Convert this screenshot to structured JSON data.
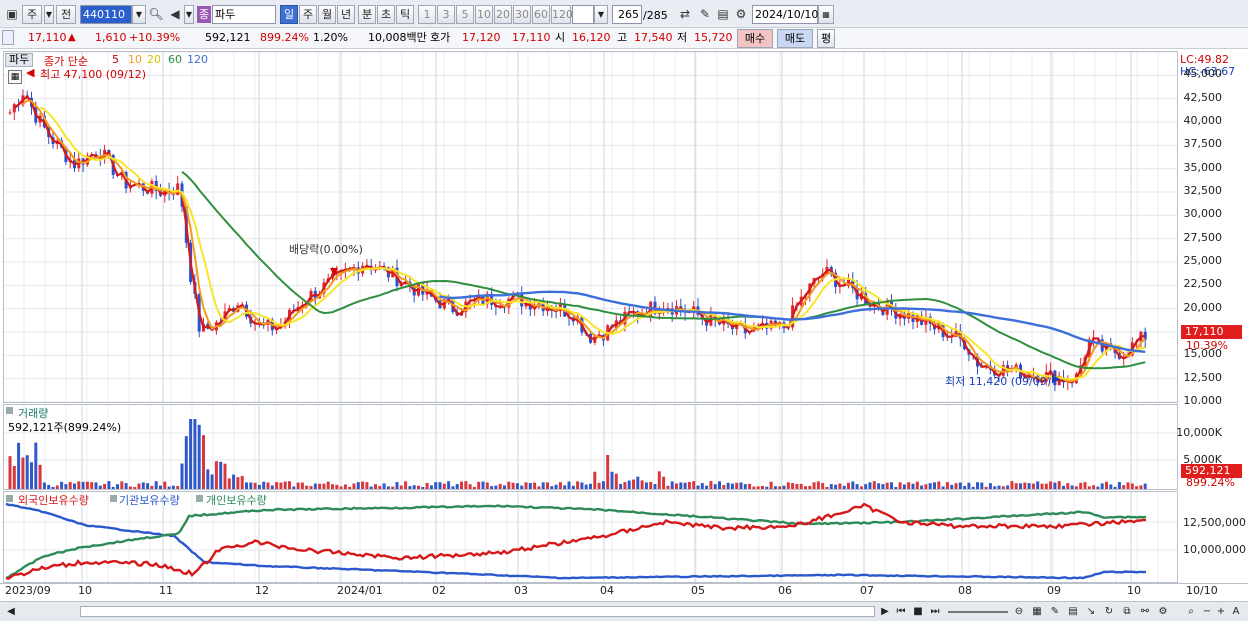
{
  "toolbar": {
    "market_label": "주",
    "prev_label": "전",
    "code": "440110",
    "name_badge": "종",
    "name": "파두",
    "periods": [
      "일",
      "주",
      "월",
      "년",
      "분",
      "초",
      "틱"
    ],
    "intervals": [
      "1",
      "3",
      "5",
      "10",
      "20",
      "30",
      "60",
      "120"
    ],
    "count": "265",
    "count_total": "/285",
    "date": "2024/10/10"
  },
  "quote": {
    "price": "17,110",
    "change": "1,610",
    "change_pct": "+10.39%",
    "volume": "592,121",
    "volume_pct": "899.24%",
    "turnover_pct": "1.20%",
    "amount": "10,008백만",
    "ask_label": "호가",
    "ask": "17,120",
    "bid": "17,110",
    "open_label": "시",
    "open": "16,120",
    "high_label": "고",
    "high": "17,540",
    "low_label": "저",
    "low": "15,720",
    "buy_button": "매수",
    "sell_button": "매도",
    "eval_button": "평"
  },
  "price_panel": {
    "stock_tag": "파두",
    "legend_title": "종가 단순",
    "ma_periods": [
      "5",
      "10",
      "20",
      "60",
      "120"
    ],
    "ma_colors": [
      "#cc0000",
      "#f39b1f",
      "#f7e52a",
      "#2f8f3e",
      "#3c6fd9"
    ],
    "high_note": "최고 47,100 (09/12)",
    "low_note": "최저 11,420 (09/09)",
    "dividend_note": "배당락(0.00%)",
    "lc": "LC:49.82",
    "hc": "HC:-63.67",
    "current_price": "17,110",
    "current_pct": "10.39%",
    "y_ticks": [
      "45,000",
      "42,500",
      "40,000",
      "37,500",
      "35,000",
      "32,500",
      "30,000",
      "27,500",
      "25,000",
      "22,500",
      "20,000",
      "15,000",
      "12,500",
      "10,000"
    ]
  },
  "volume_panel": {
    "title": "거래량",
    "value_note": "592,121주(899.24%)",
    "y_ticks": [
      "10,000K",
      "5,000K"
    ],
    "current_value": "592,121",
    "current_pct": "899.24%"
  },
  "holding_panel": {
    "legend": [
      "외국인보유수량",
      "기관보유수량",
      "개인보유수량"
    ],
    "colors": [
      "#d51818",
      "#2a58cc",
      "#2e8b57"
    ],
    "y_ticks": [
      "12,500,000",
      "10,000,000"
    ]
  },
  "x_axis": {
    "labels": [
      "2023/09",
      "10",
      "11",
      "12",
      "2024/01",
      "02",
      "03",
      "04",
      "05",
      "06",
      "07",
      "08",
      "09",
      "10"
    ],
    "end_label": "10/10"
  },
  "chart_data": {
    "type": "candlestick",
    "dates_range": [
      "2023/09",
      "2024/10/10"
    ],
    "close_series": [
      {
        "date": "2023/09",
        "close": 40000
      },
      {
        "date": "2023/10",
        "close": 35500
      },
      {
        "date": "2023/11",
        "close": 32000
      },
      {
        "date": "2023/11 late",
        "close": 18000
      },
      {
        "date": "2023/12",
        "close": 18500
      },
      {
        "date": "2024/01",
        "close": 24000
      },
      {
        "date": "2024/02",
        "close": 21000
      },
      {
        "date": "2024/03",
        "close": 19000
      },
      {
        "date": "2024/04",
        "close": 20500
      },
      {
        "date": "2024/05",
        "close": 18000
      },
      {
        "date": "2024/06",
        "close": 23500
      },
      {
        "date": "2024/07",
        "close": 19500
      },
      {
        "date": "2024/08",
        "close": 14000
      },
      {
        "date": "2024/09",
        "close": 15000
      },
      {
        "date": "2024/10/10",
        "close": 17110
      }
    ],
    "ylim": [
      10000,
      47500
    ],
    "extremes": {
      "high": 47100,
      "high_date": "09/12",
      "low": 11420,
      "low_date": "09/09"
    }
  }
}
